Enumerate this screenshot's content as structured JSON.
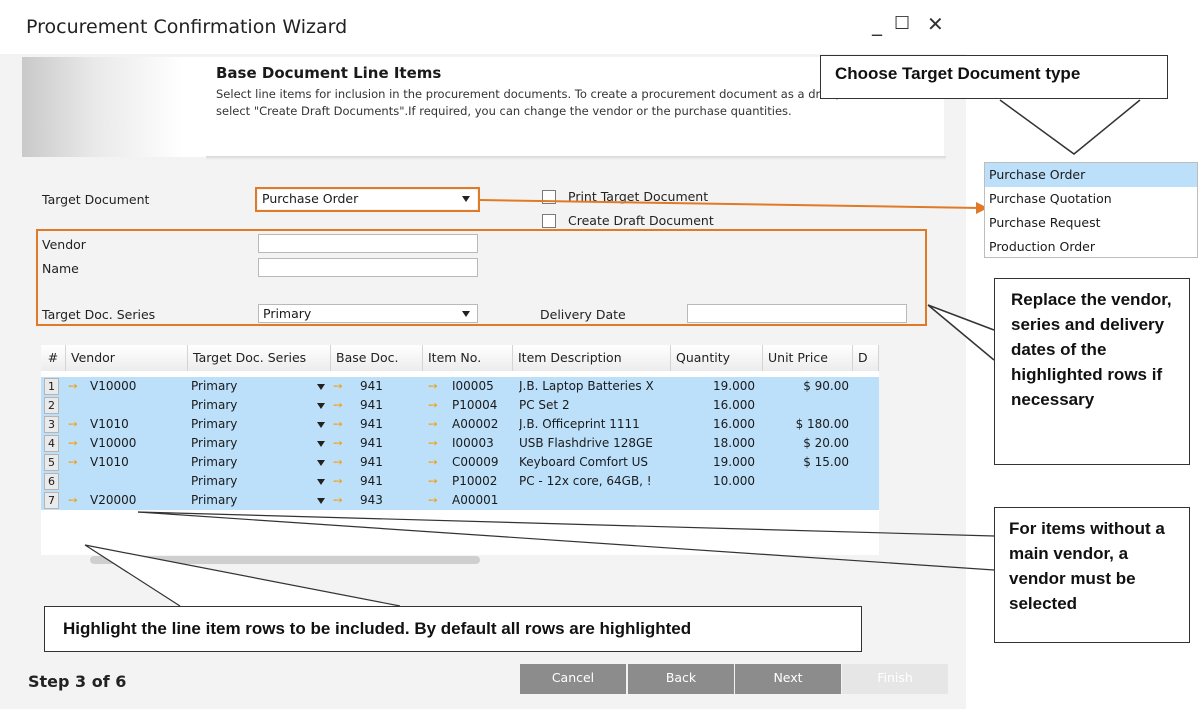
{
  "window": {
    "title": "Procurement Confirmation Wizard",
    "controls": {
      "minimize": "_",
      "maximize": "☐",
      "close": "✕"
    }
  },
  "header": {
    "title": "Base Document Line Items",
    "description": "Select line items for inclusion in the procurement documents. To create a procurement document as a draft, select \"Create Draft Documents\".If required, you can change the vendor or the purchase quantities."
  },
  "form": {
    "target_document_label": "Target Document",
    "target_document_value": "Purchase Order",
    "print_target_label": "Print Target Document",
    "create_draft_label": "Create Draft Document",
    "vendor_label": "Vendor",
    "vendor_value": "",
    "name_label": "Name",
    "name_value": "",
    "series_label": "Target Doc. Series",
    "series_value": "Primary",
    "delivery_label": "Delivery Date",
    "delivery_value": ""
  },
  "grid": {
    "headers": [
      "#",
      "Vendor",
      "Target Doc. Series",
      "Base Doc.",
      "Item No.",
      "Item Description",
      "Quantity",
      "Unit Price",
      "D"
    ],
    "rows": [
      {
        "num": "1",
        "vendor": "V10000",
        "series": "Primary",
        "base": "941",
        "item": "I00005",
        "desc": "J.B. Laptop Batteries X",
        "qty": "19.000",
        "price": "$ 90.00"
      },
      {
        "num": "2",
        "vendor": "",
        "series": "Primary",
        "base": "941",
        "item": "P10004",
        "desc": "PC Set 2",
        "qty": "16.000",
        "price": ""
      },
      {
        "num": "3",
        "vendor": "V1010",
        "series": "Primary",
        "base": "941",
        "item": "A00002",
        "desc": "J.B. Officeprint 1111",
        "qty": "16.000",
        "price": "$ 180.00"
      },
      {
        "num": "4",
        "vendor": "V10000",
        "series": "Primary",
        "base": "941",
        "item": "I00003",
        "desc": "USB Flashdrive 128GE",
        "qty": "18.000",
        "price": "$ 20.00"
      },
      {
        "num": "5",
        "vendor": "V1010",
        "series": "Primary",
        "base": "941",
        "item": "C00009",
        "desc": "Keyboard Comfort US",
        "qty": "19.000",
        "price": "$ 15.00"
      },
      {
        "num": "6",
        "vendor": "",
        "series": "Primary",
        "base": "941",
        "item": "P10002",
        "desc": "PC - 12x core, 64GB, !",
        "qty": "10.000",
        "price": ""
      },
      {
        "num": "7",
        "vendor": "V20000",
        "series": "Primary",
        "base": "943",
        "item": "A00001",
        "desc": "",
        "qty": "",
        "price": ""
      }
    ]
  },
  "footer": {
    "step": "Step 3 of 6",
    "buttons": {
      "cancel": "Cancel",
      "back": "Back",
      "next": "Next",
      "finish": "Finish"
    }
  },
  "dropdown_options": [
    "Purchase Order",
    "Purchase Quotation",
    "Purchase Request",
    "Production Order"
  ],
  "callouts": {
    "type": "Choose Target Document type",
    "replace": "Replace the vendor, series and delivery dates of the highlighted rows if necessary",
    "vendor": "For items without a main vendor, a vendor must be selected",
    "highlight": "Highlight the line item rows to be included. By default all rows are highlighted"
  },
  "colors": {
    "accent_orange": "#e07a26",
    "row_highlight": "#bde0fa",
    "arrow_orange": "#f1a21c"
  }
}
